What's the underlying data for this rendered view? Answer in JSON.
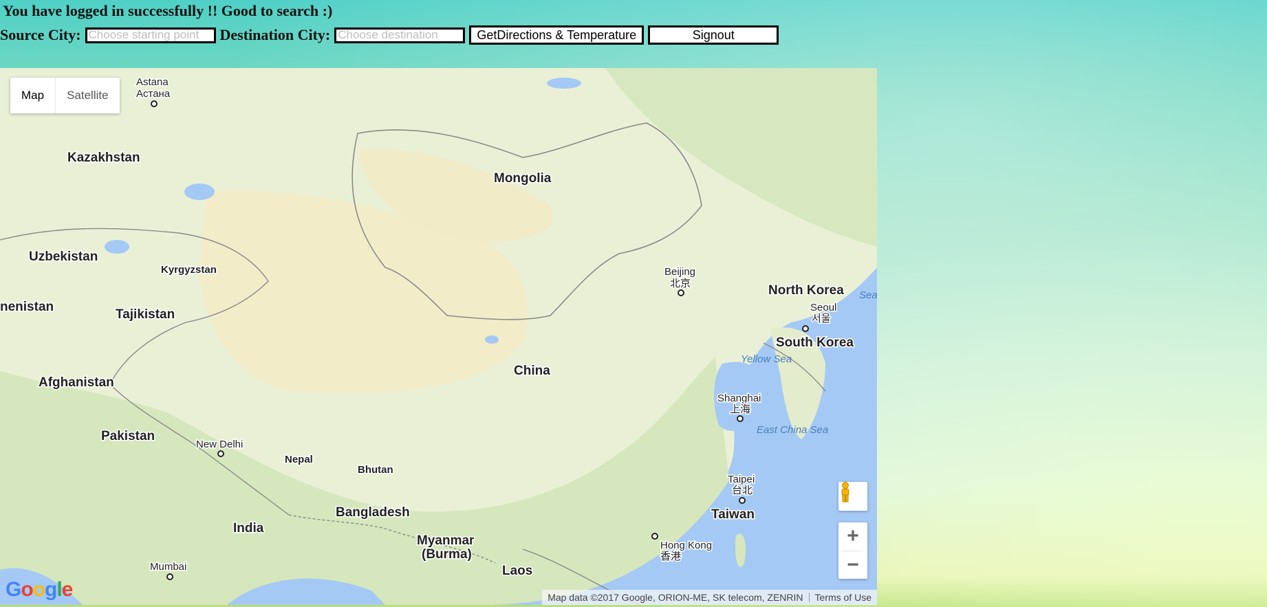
{
  "header": {
    "message": "You have logged in successfully !! Good to search :)"
  },
  "form": {
    "source_label": "Source City:",
    "source_placeholder": "Choose starting point",
    "source_value": "",
    "destination_label": "Destination City:",
    "destination_placeholder": "Choose destination",
    "destination_value": "",
    "directions_button": "GetDirections & Temperature",
    "signout_button": "Signout"
  },
  "map": {
    "map_types": [
      "Map",
      "Satellite"
    ],
    "selected_map_type": "Map",
    "countries": [
      "Kazakhstan",
      "Mongolia",
      "Uzbekistan",
      "Kyrgyzstan",
      "nenistan",
      "Tajikistan",
      "North Korea",
      "South Korea",
      "Afghanistan",
      "China",
      "Pakistan",
      "Nepal",
      "Bhutan",
      "Bangladesh",
      "India",
      "Myanmar",
      "(Burma)",
      "Laos",
      "Taiwan"
    ],
    "cities": [
      "Astana",
      "Астана",
      "Beijing",
      "北京",
      "Seoul",
      "서울",
      "New Delhi",
      "Shanghai",
      "上海",
      "Taipei",
      "台北",
      "Hong Kong",
      "香港",
      "Mumbai"
    ],
    "seas": [
      "Sea",
      "Yellow Sea",
      "East China Sea"
    ],
    "zoom_in": "+",
    "zoom_out": "−",
    "logo": "Google",
    "attribution": "Map data ©2017 Google, ORION-ME, SK telecom, ZENRIN",
    "terms": "Terms of Use"
  },
  "colors": {
    "land": "#eaf0d6",
    "water": "#a5c9f5",
    "desert": "#f3ecc9",
    "forest": "#cfe3b4"
  },
  "icons": [
    "pegman-icon",
    "zoom-in-icon",
    "zoom-out-icon",
    "city-marker-icon"
  ]
}
